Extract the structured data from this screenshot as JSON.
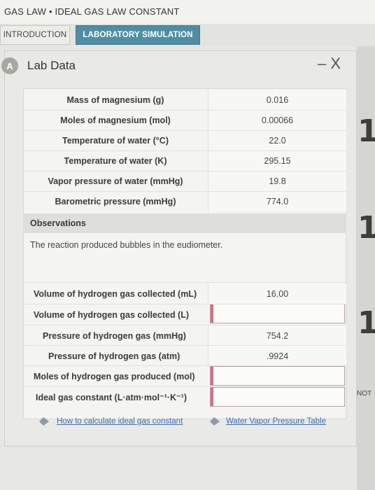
{
  "header": {
    "breadcrumb": "GAS LAW • IDEAL GAS LAW CONSTANT"
  },
  "tabs": [
    {
      "label": "INTRODUCTION"
    },
    {
      "label": "LABORATORY SIMULATION"
    }
  ],
  "panel": {
    "badge": "A",
    "title": "Lab Data",
    "window_controls": "– X"
  },
  "lab_data": {
    "rows": [
      {
        "label": "Mass of magnesium (g)",
        "value": "0.016"
      },
      {
        "label": "Moles of magnesium (mol)",
        "value": "0.00066"
      },
      {
        "label": "Temperature of water (°C)",
        "value": "22.0"
      },
      {
        "label": "Temperature of water (K)",
        "value": "295.15"
      },
      {
        "label": "Vapor pressure of water (mmHg)",
        "value": "19.8"
      },
      {
        "label": "Barometric pressure (mmHg)",
        "value": "774.0"
      }
    ],
    "observations_label": "Observations",
    "observations_text": "The reaction produced bubbles in the eudiometer.",
    "results": [
      {
        "label": "Volume of hydrogen gas collected (mL)",
        "value": "16.00"
      },
      {
        "label": "Volume of hydrogen gas collected (L)",
        "value": ""
      },
      {
        "label": "Pressure of hydrogen gas (mmHg)",
        "value": "754.2"
      },
      {
        "label": "Pressure of hydrogen gas (atm)",
        "value": ".9924"
      },
      {
        "label": "Moles of hydrogen gas produced (mol)",
        "value": ""
      },
      {
        "label": "Ideal gas constant (L·atm·mol⁻¹·K⁻¹)",
        "value": ""
      }
    ]
  },
  "links": [
    {
      "label": "How to calculate ideal gas constant"
    },
    {
      "label": "Water Vapor Pressure Table"
    }
  ],
  "side_panel": {
    "digits": [
      "1",
      "1",
      "1"
    ],
    "note": "NOT"
  },
  "colors": {
    "tab_active": "#4f8ea2",
    "input_accent": "#d26e84",
    "link": "#3c6fb0"
  }
}
